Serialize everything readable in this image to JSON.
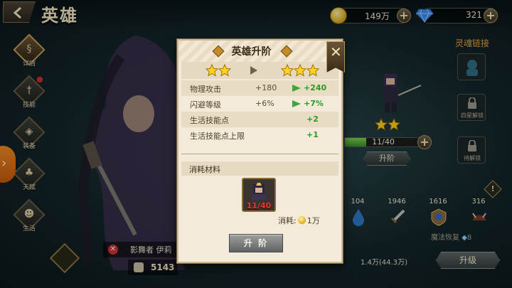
{
  "header": {
    "title": "英雄",
    "gold": "149万",
    "gems": "321"
  },
  "left_menu": [
    {
      "label": "详情",
      "icon": "scroll-icon",
      "active": true
    },
    {
      "label": "技能",
      "icon": "sword-icon",
      "active": false,
      "badge": true
    },
    {
      "label": "装备",
      "icon": "shield-icon",
      "active": false
    },
    {
      "label": "天赋",
      "icon": "tree-icon",
      "active": false
    },
    {
      "label": "生活",
      "icon": "life-icon",
      "active": false
    }
  ],
  "hero": {
    "name": "影舞者 伊莉",
    "power": "5143",
    "stars": 2,
    "xp_text": "11/40",
    "xp_fraction": 0.275
  },
  "right_panel": {
    "soul_link_title": "灵魂链接",
    "slots": [
      {
        "label": "",
        "locked": false
      },
      {
        "label": "四星解锁",
        "locked": true
      },
      {
        "label": "待解锁",
        "locked": true
      }
    ],
    "step_button": "升阶",
    "materials": [
      {
        "count": "104",
        "icon": "water-drop-icon"
      },
      {
        "count": "1946",
        "icon": "sword-material-icon"
      },
      {
        "count": "1616",
        "icon": "badge-material-icon"
      },
      {
        "count": "316",
        "icon": "helmet-material-icon"
      }
    ],
    "material_caption": "魔法恢复",
    "material_caption_value": "8",
    "gold_cost": "1.4万(44.3万)",
    "levelup_button": "升级"
  },
  "modal": {
    "title": "英雄升阶",
    "stars_before": 2,
    "stars_after": 3,
    "stats": [
      {
        "label": "物理攻击",
        "old": "+180",
        "new": "+240"
      },
      {
        "label": "闪避等级",
        "old": "+6%",
        "new": "+7%"
      },
      {
        "label": "生活技能点",
        "old": "",
        "new": "+2"
      },
      {
        "label": "生活技能点上限",
        "old": "",
        "new": "+1"
      }
    ],
    "consume_label": "消耗材料",
    "material_qty": "11/40",
    "cost_label": "消耗:",
    "cost_value": "1万",
    "confirm_button": "升 阶"
  },
  "colors": {
    "accent_gold": "#e3b830",
    "stat_increase": "#2c9a25",
    "insufficient": "#ff3030",
    "soul_link": "#e9a445"
  }
}
